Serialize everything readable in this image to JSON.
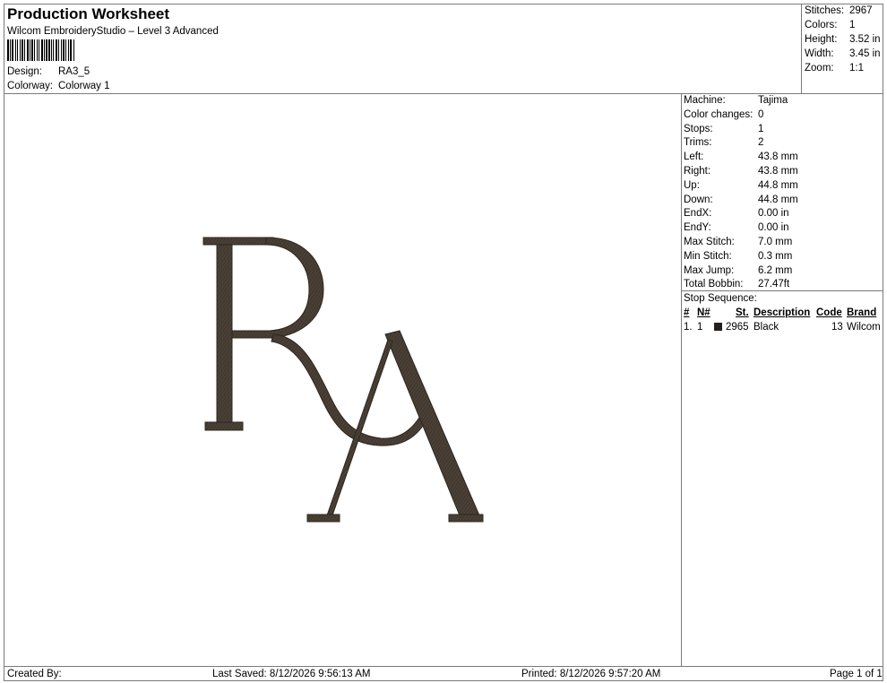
{
  "header": {
    "title": "Production Worksheet",
    "subtitle": "Wilcom EmbroideryStudio – Level 3 Advanced",
    "design_label": "Design:",
    "design_value": "RA3_5",
    "colorway_label": "Colorway:",
    "colorway_value": "Colorway 1"
  },
  "stats": [
    {
      "label": "Stitches:",
      "value": "2967"
    },
    {
      "label": "Colors:",
      "value": "1"
    },
    {
      "label": "Height:",
      "value": "3.52 in"
    },
    {
      "label": "Width:",
      "value": "3.45 in"
    },
    {
      "label": "Zoom:",
      "value": "1:1"
    }
  ],
  "info": [
    {
      "label": "Machine:",
      "value": "Tajima"
    },
    {
      "label": "Color changes:",
      "value": "0"
    },
    {
      "label": "Stops:",
      "value": "1"
    },
    {
      "label": "Trims:",
      "value": "2"
    },
    {
      "label": "Left:",
      "value": "43.8 mm"
    },
    {
      "label": "Right:",
      "value": "43.8 mm"
    },
    {
      "label": "Up:",
      "value": "44.8 mm"
    },
    {
      "label": "Down:",
      "value": "44.8 mm"
    },
    {
      "label": "EndX:",
      "value": "0.00 in"
    },
    {
      "label": "EndY:",
      "value": "0.00 in"
    },
    {
      "label": "Max Stitch:",
      "value": "7.0 mm"
    },
    {
      "label": "Min Stitch:",
      "value": "0.3 mm"
    },
    {
      "label": "Max Jump:",
      "value": "6.2 mm"
    },
    {
      "label": "Total Bobbin:",
      "value": "27.47ft"
    }
  ],
  "sequence": {
    "title": "Stop Sequence:",
    "headers": {
      "num": "#",
      "n": "N#",
      "st": "St.",
      "description": "Description",
      "code": "Code",
      "brand": "Brand"
    },
    "rows": [
      {
        "num": "1.",
        "n": "1",
        "color": "#231f1c",
        "st": "2965",
        "description": "Black",
        "code": "13",
        "brand": "Wilcom"
      }
    ]
  },
  "footer": {
    "created_by": "Created By:",
    "last_saved": "Last Saved: 8/12/2026 9:56:13 AM",
    "printed": "Printed: 8/12/2026 9:57:20 AM",
    "page": "Page 1 of 1"
  },
  "colors": {
    "thread": "#4a4036",
    "thread_dark": "#2e2720",
    "border": "#7a7a7a"
  }
}
